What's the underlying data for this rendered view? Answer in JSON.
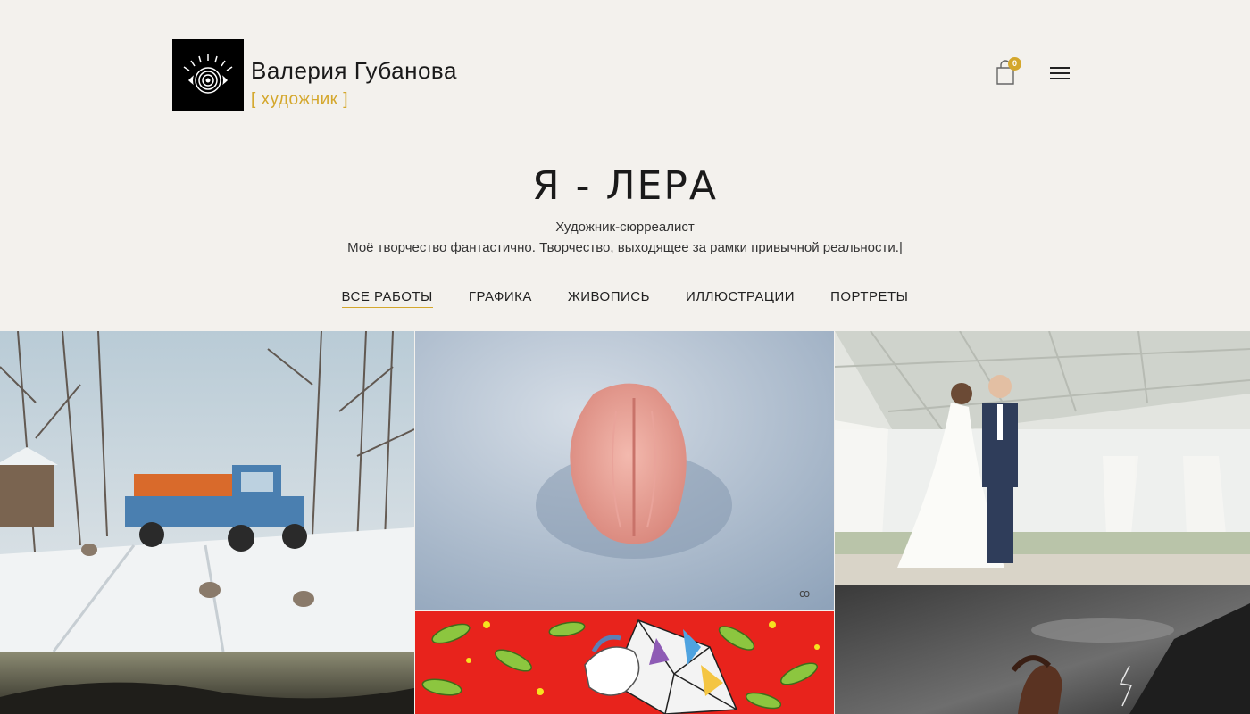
{
  "header": {
    "brand_name": "Валерия Губанова",
    "brand_subtitle": "[ художник ]",
    "logo_icon": "spiral-eye-icon",
    "cart_icon": "shopping-bag-icon",
    "cart_count": "0",
    "menu_icon": "hamburger-menu-icon"
  },
  "hero": {
    "title": "Я - ЛЕРА",
    "subtitle": "Художник-сюрреалист",
    "tagline": "Моё творчество фантастично. Творчество, выходящее за рамки привычной реальности.|"
  },
  "filters": [
    {
      "label": "ВСЕ РАБОТЫ",
      "active": true
    },
    {
      "label": "ГРАФИКА",
      "active": false
    },
    {
      "label": "ЖИВОПИСЬ",
      "active": false
    },
    {
      "label": "ИЛЛЮСТРАЦИИ",
      "active": false
    },
    {
      "label": "ПОРТРЕТЫ",
      "active": false
    }
  ],
  "colors": {
    "background": "#f3f1ed",
    "accent": "#d4a72c",
    "text": "#1a1a1a"
  }
}
